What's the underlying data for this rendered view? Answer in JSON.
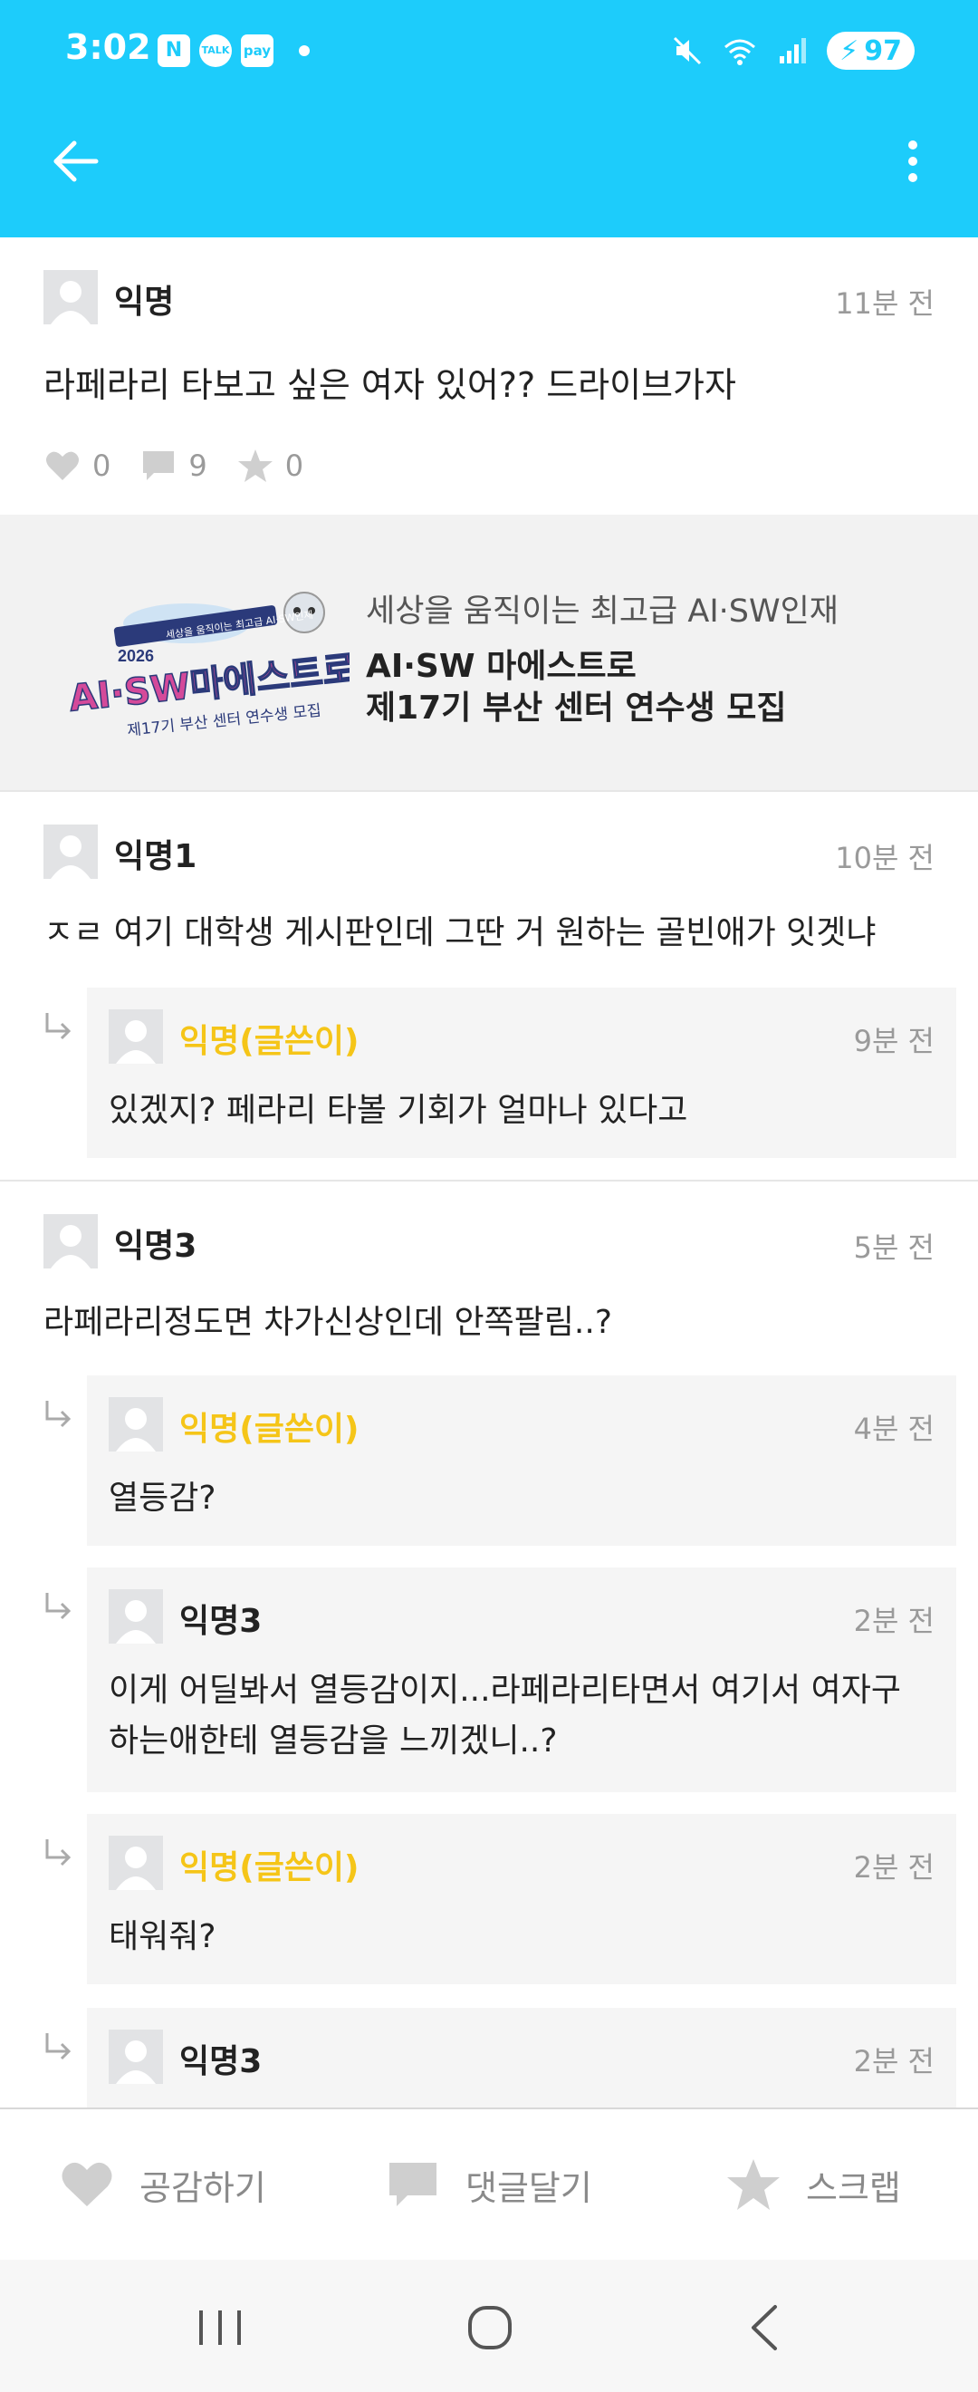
{
  "status_bar": {
    "time": "3:02",
    "notifications": [
      "N",
      "TALK",
      "pay"
    ],
    "battery": "97"
  },
  "colors": {
    "header": "#1dccfb",
    "author_op": "#f5c518",
    "meta_gray": "#9a9a9a"
  },
  "icons": {
    "back": "arrow-left-icon",
    "more": "more-vertical-icon",
    "like": "heart-icon",
    "comment": "speech-bubble-icon",
    "scrap": "star-icon",
    "reply": "reply-arrow-icon"
  },
  "post": {
    "author": "익명",
    "time": "11분 전",
    "body": "라페라리 타보고 싶은 여자 있어?? 드라이브가자",
    "likes": "0",
    "comments": "9",
    "scraps": "0"
  },
  "ad": {
    "banner_year": "2026",
    "banner_tagline": "세상을 움직이는 최고급 AI·SW인재",
    "banner_title": "AI·SW마에스트로",
    "banner_subtitle": "제17기 부산 센터 연수생 모집",
    "subtitle": "세상을 움직이는 최고급 AI·SW인재",
    "title_line1": "AI·SW 마에스트로",
    "title_line2": "제17기 부산 센터 연수생 모집"
  },
  "comments": [
    {
      "author": "익명1",
      "time": "10분 전",
      "body": "ㅈㄹ 여기 대학생 게시판인데 그딴 거 원하는 골빈애가 잇겟냐",
      "replies": [
        {
          "author": "익명(글쓴이)",
          "time": "9분 전",
          "body": "있겠지? 페라리 타볼 기회가 얼마나 있다고"
        }
      ]
    },
    {
      "author": "익명3",
      "time": "5분 전",
      "body": "라페라리정도면 차가신상인데 안쪽팔림..?",
      "replies": [
        {
          "author": "익명(글쓴이)",
          "time": "4분 전",
          "body": "열등감?"
        },
        {
          "author": "익명3",
          "time": "2분 전",
          "body": "이게 어딜봐서 열등감이지...라페라리타면서 여기서 여자구하는애한테 열등감을 느끼겠니..?"
        },
        {
          "author": "익명(글쓴이)",
          "time": "2분 전",
          "body": "태워줘?"
        },
        {
          "author": "익명3",
          "time": "2분 전",
          "body": ""
        }
      ]
    }
  ],
  "bottom_bar": {
    "like_label": "공감하기",
    "comment_label": "댓글달기",
    "scrap_label": "스크랩"
  }
}
